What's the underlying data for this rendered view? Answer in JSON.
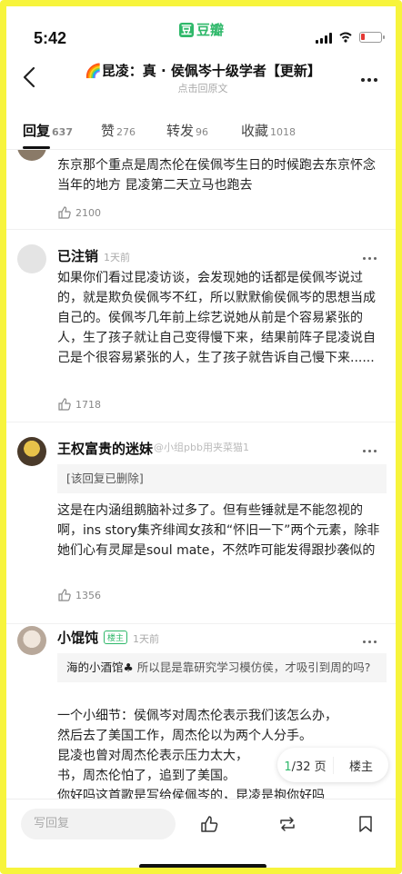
{
  "status": {
    "time": "5:42",
    "app_name": "豆瓣",
    "app_logo_char": "豆"
  },
  "nav": {
    "title": "🌈昆凌：真 · 侯佩岑十级学者【更新】",
    "subtitle": "点击回原文"
  },
  "tabs": [
    {
      "label": "回复",
      "count": "637"
    },
    {
      "label": "赞",
      "count": "276"
    },
    {
      "label": "转发",
      "count": "96"
    },
    {
      "label": "收藏",
      "count": "1018"
    }
  ],
  "comments": [
    {
      "text": "东京那个重点是周杰伦在侯佩岑生日的时候跑去东京怀念当年的地方 昆凌第二天立马也跑去",
      "likes": "2100"
    },
    {
      "user": "已注销",
      "time": "1天前",
      "text": "如果你们看过昆凌访谈，会发现她的话都是侯佩岑说过的，就是欺负侯佩岑不红，所以默默偷侯佩岑的思想当成自己的。侯佩岑几年前上综艺说她从前是个容易紧张的人，生了孩子就让自己变得慢下来，结果前阵子昆凌说自己是个很容易紧张的人，生了孩子就告诉自己慢下来......",
      "likes": "1718"
    },
    {
      "user": "王权富贵的迷妹",
      "quote": "[该回复已删除]",
      "text": "这是在内涵组鹅脑补过多了。但有些锤就是不能忽视的啊，ins story集齐绯闻女孩和“怀旧一下”两个元素，除非她们心有灵犀是soul mate，不然咋可能发得跟抄袭似的",
      "likes": "1356"
    },
    {
      "user": "小馄饨",
      "badge": "楼主",
      "time": "1天前",
      "quote_user": "海的小酒馆♣",
      "quote": "所以昆是靠研究学习模仿侯，才吸引到周的吗?",
      "text_lines": [
        "一个小细节：侯佩岑对周杰伦表示我们该怎么办，",
        "然后去了美国工作，周杰伦以为两个人分手。",
        "昆凌也曾对周杰伦表示压力太大，",
        "书，周杰伦怕了，追到了美国。",
        "你好吗这首歌是写给侯佩岑的，昆凌是抱你好吗"
      ]
    }
  ],
  "watermark": "@小组pbb用夹菜猫1",
  "pager": {
    "current": "1",
    "total": "/32 页",
    "op_label": "楼主"
  },
  "bottom": {
    "reply_placeholder": "写回复"
  }
}
